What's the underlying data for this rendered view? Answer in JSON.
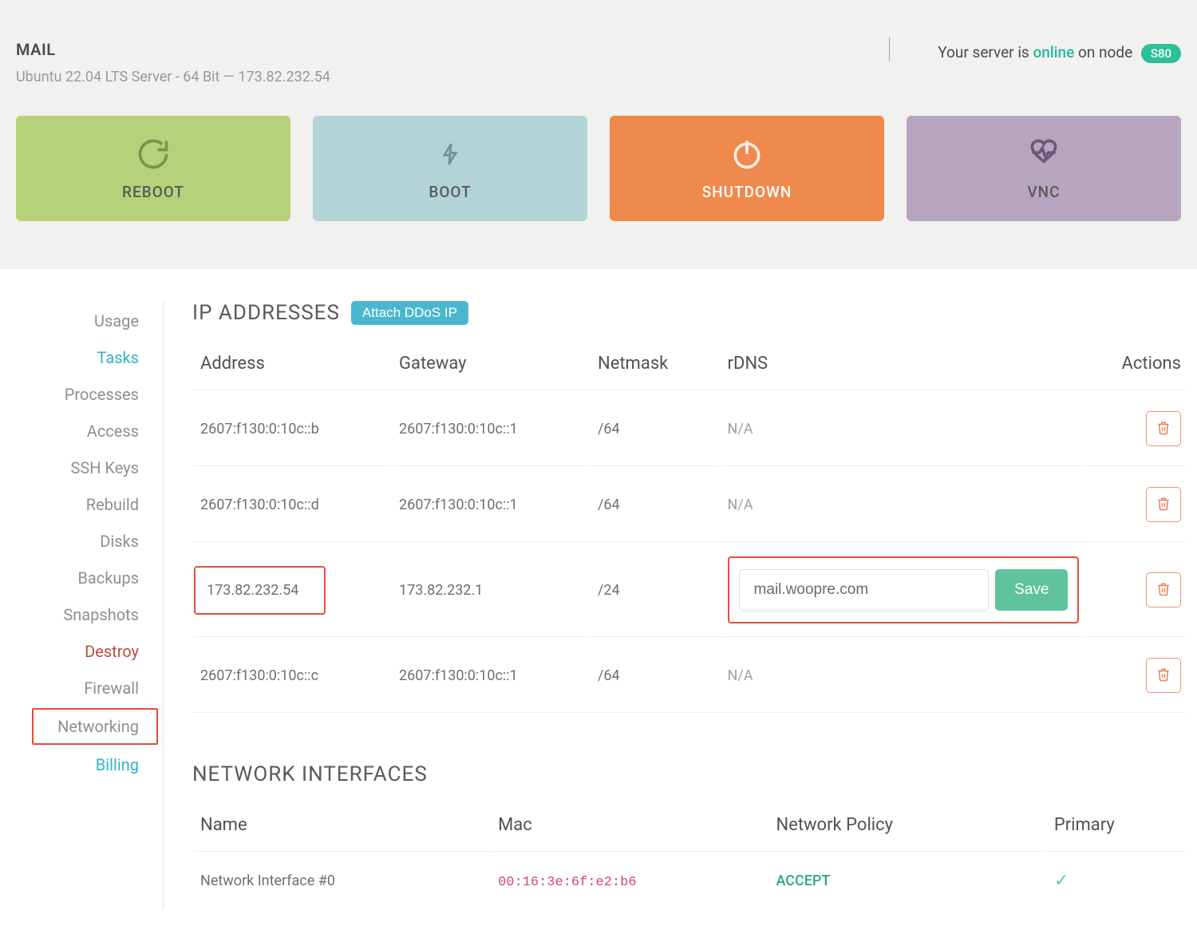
{
  "header": {
    "server_name": "MAIL",
    "subtitle": "Ubuntu 22.04 LTS Server - 64 Bit — 173.82.232.54",
    "status_prefix": "Your server is ",
    "status_word": "online",
    "status_mid": " on node ",
    "node_badge": "S80"
  },
  "actions": {
    "reboot": "REBOOT",
    "boot": "BOOT",
    "shutdown": "SHUTDOWN",
    "vnc": "VNC"
  },
  "sidebar": {
    "items": [
      {
        "label": "Usage"
      },
      {
        "label": "Tasks"
      },
      {
        "label": "Processes"
      },
      {
        "label": "Access"
      },
      {
        "label": "SSH Keys"
      },
      {
        "label": "Rebuild"
      },
      {
        "label": "Disks"
      },
      {
        "label": "Backups"
      },
      {
        "label": "Snapshots"
      },
      {
        "label": "Destroy"
      },
      {
        "label": "Firewall"
      },
      {
        "label": "Networking"
      },
      {
        "label": "Billing"
      }
    ]
  },
  "ip_section": {
    "title": "IP ADDRESSES",
    "attach_btn": "Attach DDoS IP",
    "columns": {
      "address": "Address",
      "gateway": "Gateway",
      "netmask": "Netmask",
      "rdns": "rDNS",
      "actions": "Actions"
    },
    "rows": [
      {
        "address": "2607:f130:0:10c::b",
        "gateway": "2607:f130:0:10c::1",
        "netmask": "/64",
        "rdns_text": "N/A",
        "editable": false
      },
      {
        "address": "2607:f130:0:10c::d",
        "gateway": "2607:f130:0:10c::1",
        "netmask": "/64",
        "rdns_text": "N/A",
        "editable": false
      },
      {
        "address": "173.82.232.54",
        "gateway": "173.82.232.1",
        "netmask": "/24",
        "rdns_value": "mail.woopre.com",
        "save_label": "Save",
        "editable": true
      },
      {
        "address": "2607:f130:0:10c::c",
        "gateway": "2607:f130:0:10c::1",
        "netmask": "/64",
        "rdns_text": "N/A",
        "editable": false
      }
    ]
  },
  "net_section": {
    "title": "NETWORK INTERFACES",
    "columns": {
      "name": "Name",
      "mac": "Mac",
      "policy": "Network Policy",
      "primary": "Primary"
    },
    "rows": [
      {
        "name": "Network Interface #0",
        "mac": "00:16:3e:6f:e2:b6",
        "policy": "ACCEPT",
        "primary": "✓"
      }
    ]
  },
  "colors": {
    "accent_teal": "#2fb3c9",
    "green": "#2cc197",
    "orange": "#f0894d",
    "red_outline": "#e74c3c"
  }
}
